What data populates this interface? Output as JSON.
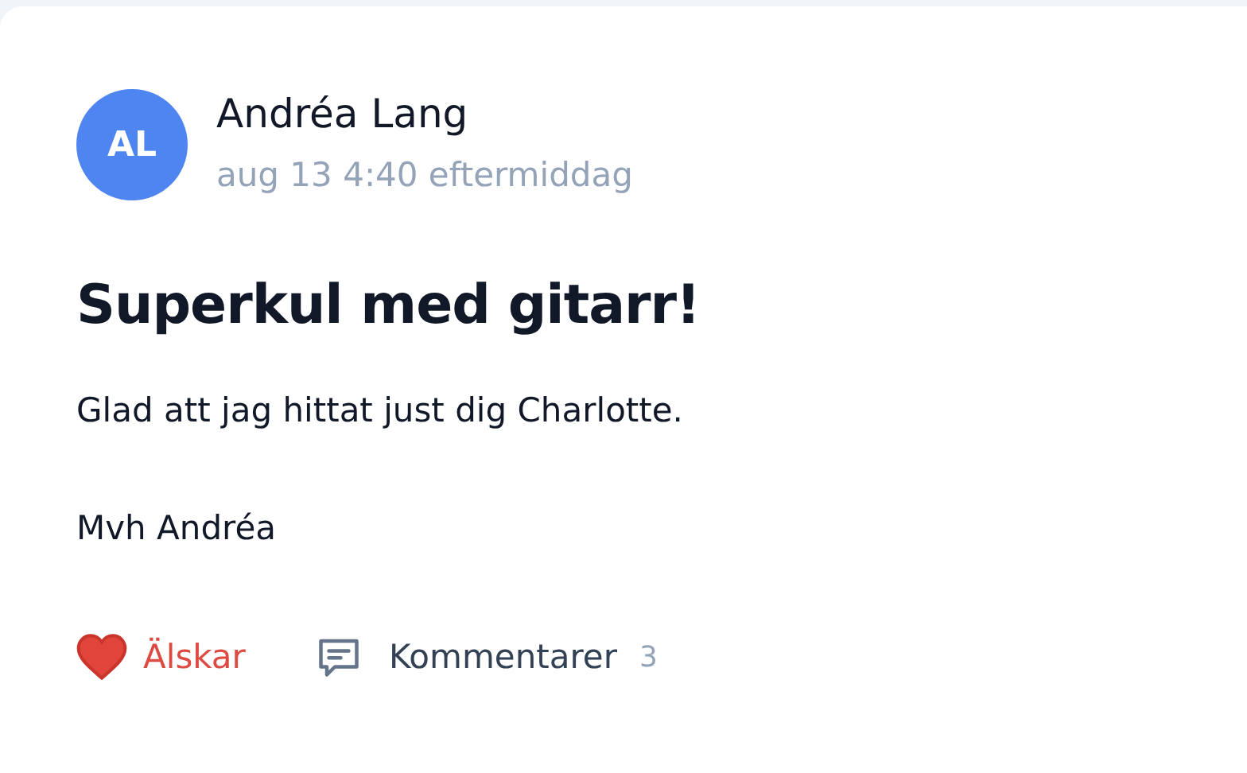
{
  "post": {
    "author": {
      "initials": "AL",
      "name": "Andréa Lang",
      "time": "aug 13 4:40 eftermiddag"
    },
    "title": "Superkul med gitarr!",
    "paragraphs": [
      "Glad att jag hittat just dig Charlotte.",
      "Mvh Andréa"
    ],
    "actions": {
      "love": {
        "label": "Älskar",
        "loved": true
      },
      "comments": {
        "label": "Kommentarer",
        "count": "3"
      }
    }
  }
}
